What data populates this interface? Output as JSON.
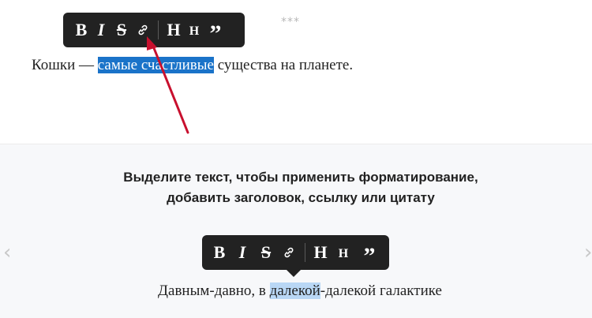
{
  "top_example": {
    "toolbar": {
      "bold": "B",
      "italic": "I",
      "strike": "S",
      "h1": "H",
      "h2": "H",
      "quote": "”"
    },
    "separator_asterisks": "***",
    "text_before": "Кошки — ",
    "text_selected": "самые счастливые",
    "text_after": " существа на планете."
  },
  "tip": {
    "line1": "Выделите текст, чтобы применить форматирование,",
    "line2": "добавить заголовок, ссылку или цитату"
  },
  "bottom_example": {
    "toolbar": {
      "bold": "B",
      "italic": "I",
      "strike": "S",
      "h1": "H",
      "h2": "H",
      "quote": "”"
    },
    "text_before": "Давным-давно, в ",
    "text_selected": "далекой",
    "text_after": "-далекой галактике"
  },
  "navigation": {
    "prev_icon": "chevron-left-icon",
    "next_icon": "chevron-right-icon",
    "prev_glyph": "‹",
    "next_glyph": "›"
  },
  "colors": {
    "toolbar_bg": "#222222",
    "selection_strong": "#1a73c9",
    "selection_light": "#b9d7f5",
    "annotation_arrow": "#c8102e",
    "panel_bg": "#f7f8fa"
  }
}
